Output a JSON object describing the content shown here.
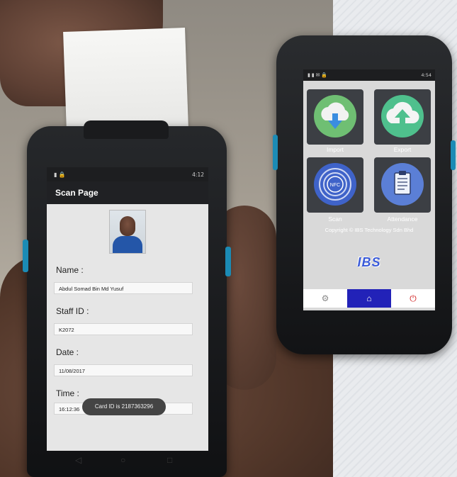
{
  "left_device": {
    "status_time": "4:12",
    "app_title": "Scan Page",
    "fields": [
      {
        "label": "Name :",
        "value": "Abdul Somad Bin Md Yusuf"
      },
      {
        "label": "Staff ID :",
        "value": "K2072"
      },
      {
        "label": "Date :",
        "value": "11/08/2017"
      },
      {
        "label": "Time :",
        "value": "16:12:36"
      }
    ],
    "toast": "Card ID is 2187363296"
  },
  "right_device": {
    "status_time": "4:54",
    "tiles": [
      {
        "label": "Import",
        "icon": "cloud-download-icon",
        "color": "#6fbf73"
      },
      {
        "label": "Export",
        "icon": "cloud-upload-icon",
        "color": "#4fc08d"
      },
      {
        "label": "Scan",
        "icon": "nfc-icon",
        "color": "#3f63c9"
      },
      {
        "label": "Attendance",
        "icon": "clipboard-icon",
        "color": "#5b7fd6"
      }
    ],
    "copyright": "Copyright © IBS Technology Sdn Bhd",
    "logo_text": "IBS",
    "bottom_nav": [
      {
        "icon": "settings-icon"
      },
      {
        "icon": "home-icon"
      },
      {
        "icon": "exit-icon"
      }
    ]
  }
}
